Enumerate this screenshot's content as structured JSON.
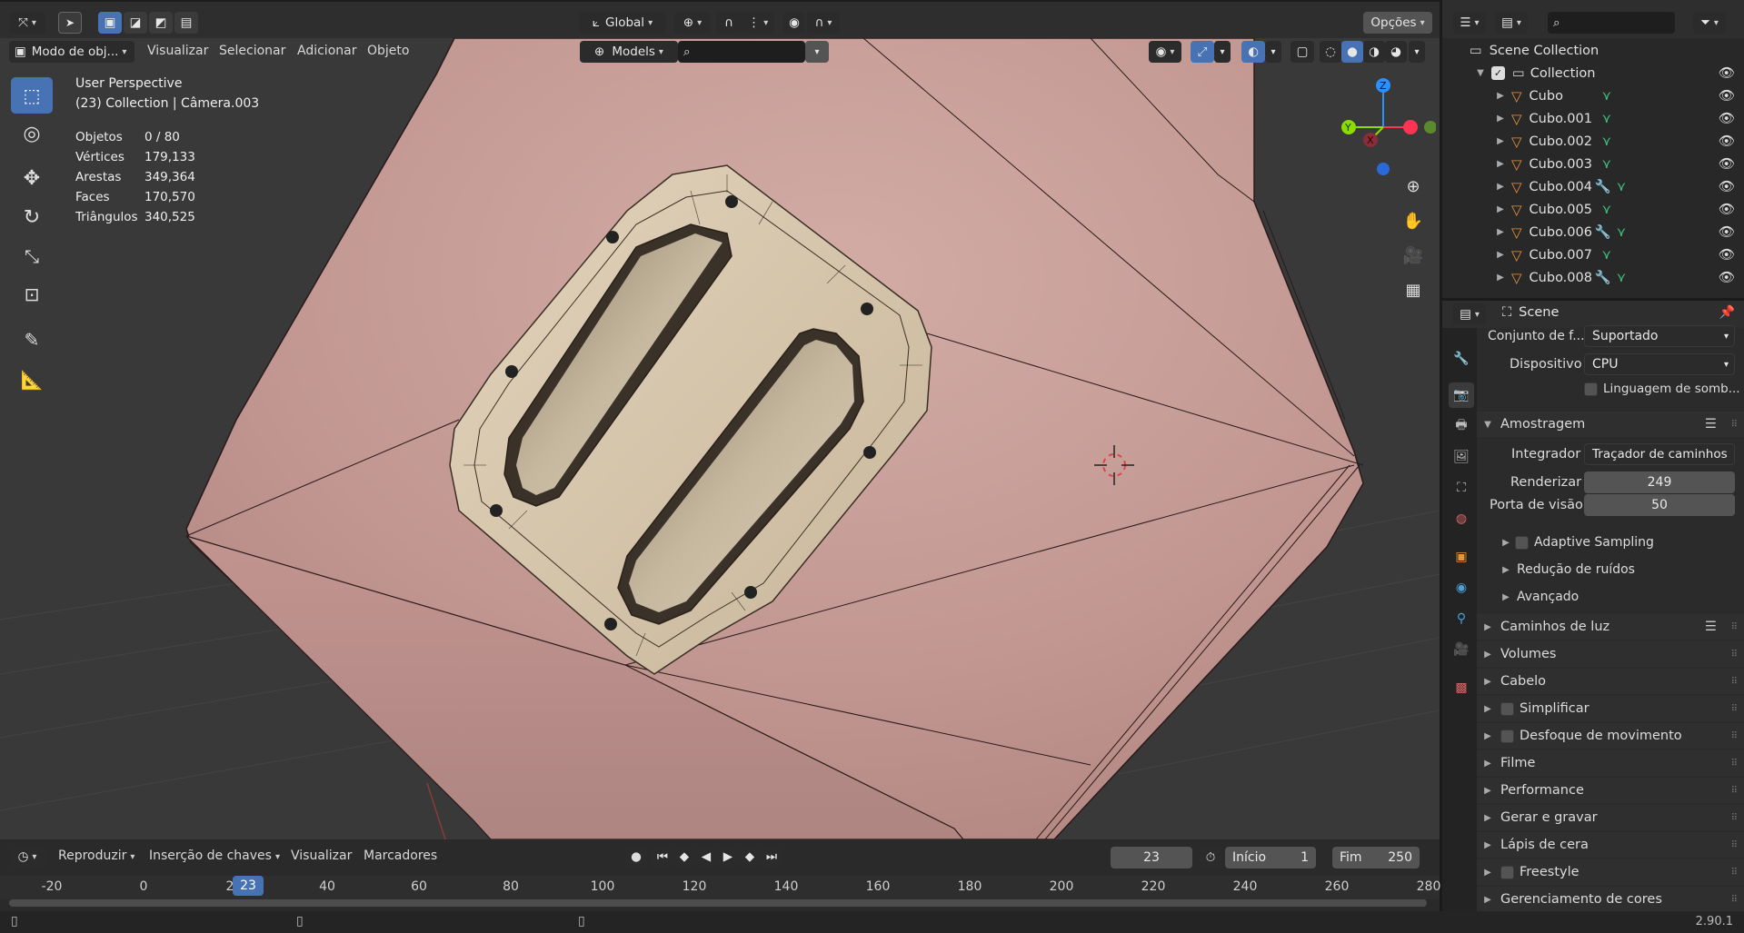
{
  "top_header": {
    "global_label": "Global",
    "options_label": "Opções"
  },
  "vp_header": {
    "mode_label": "Modo de obj...",
    "menu": [
      "Visualizar",
      "Selecionar",
      "Adicionar",
      "Objeto"
    ],
    "collection_selector": "Models"
  },
  "overlay": {
    "view_name": "User Perspective",
    "context": "(23) Collection | Câmera.003",
    "stats": [
      {
        "label": "Objetos",
        "value": "0 / 80"
      },
      {
        "label": "Vértices",
        "value": "179,133"
      },
      {
        "label": "Arestas",
        "value": "349,364"
      },
      {
        "label": "Faces",
        "value": "170,570"
      },
      {
        "label": "Triângulos",
        "value": "340,525"
      }
    ]
  },
  "gizmo": {
    "x": "X",
    "y": "Y",
    "z": "Z"
  },
  "outliner": {
    "scene_collection": "Scene Collection",
    "collection": "Collection",
    "items": [
      {
        "name": "Cubo",
        "modifier": false
      },
      {
        "name": "Cubo.001",
        "modifier": false
      },
      {
        "name": "Cubo.002",
        "modifier": false
      },
      {
        "name": "Cubo.003",
        "modifier": false
      },
      {
        "name": "Cubo.004",
        "modifier": true
      },
      {
        "name": "Cubo.005",
        "modifier": false
      },
      {
        "name": "Cubo.006",
        "modifier": true
      },
      {
        "name": "Cubo.007",
        "modifier": false
      },
      {
        "name": "Cubo.008",
        "modifier": true
      }
    ]
  },
  "properties": {
    "header_title": "Scene",
    "feature_set_label": "Conjunto de f...",
    "feature_set_value": "Suportado",
    "device_label": "Dispositivo",
    "device_value": "CPU",
    "shading_language_label": "Linguagem de somb...",
    "sampling_label": "Amostragem",
    "integrator_label": "Integrador",
    "integrator_value": "Traçador de caminhos",
    "render_label": "Renderizar",
    "render_value": "249",
    "viewport_label": "Porta de visão",
    "viewport_value": "50",
    "sub_panels": [
      "Adaptive Sampling",
      "Redução de ruídos",
      "Avançado"
    ],
    "panels": [
      {
        "label": "Caminhos de luz",
        "checkbox": false,
        "list": true
      },
      {
        "label": "Volumes",
        "checkbox": false,
        "list": false
      },
      {
        "label": "Cabelo",
        "checkbox": false,
        "list": false
      },
      {
        "label": "Simplificar",
        "checkbox": true,
        "list": false
      },
      {
        "label": "Desfoque de movimento",
        "checkbox": true,
        "list": false
      },
      {
        "label": "Filme",
        "checkbox": false,
        "list": false
      },
      {
        "label": "Performance",
        "checkbox": false,
        "list": false
      },
      {
        "label": "Gerar e gravar",
        "checkbox": false,
        "list": false
      },
      {
        "label": "Lápis de cera",
        "checkbox": false,
        "list": false
      },
      {
        "label": "Freestyle",
        "checkbox": true,
        "list": false
      },
      {
        "label": "Gerenciamento de cores",
        "checkbox": false,
        "list": false
      }
    ]
  },
  "timeline": {
    "menu": [
      "Reproduzir",
      "Inserção de chaves",
      "Visualizar",
      "Marcadores"
    ],
    "current_frame": "23",
    "start_label": "Início",
    "start_value": "1",
    "end_label": "Fim",
    "end_value": "250",
    "ruler_ticks": [
      "-20",
      "0",
      "2",
      "40",
      "60",
      "80",
      "100",
      "120",
      "140",
      "160",
      "180",
      "200",
      "220",
      "240",
      "260",
      "280"
    ],
    "playhead": "23"
  },
  "status": {
    "version": "2.90.1"
  },
  "colors": {
    "accent": "#4772b3",
    "mesh": "#c49a94",
    "viewport_bg": "#393939",
    "x_axis": "#ff3352",
    "y_axis": "#8bdc00",
    "z_axis": "#2890ff"
  }
}
